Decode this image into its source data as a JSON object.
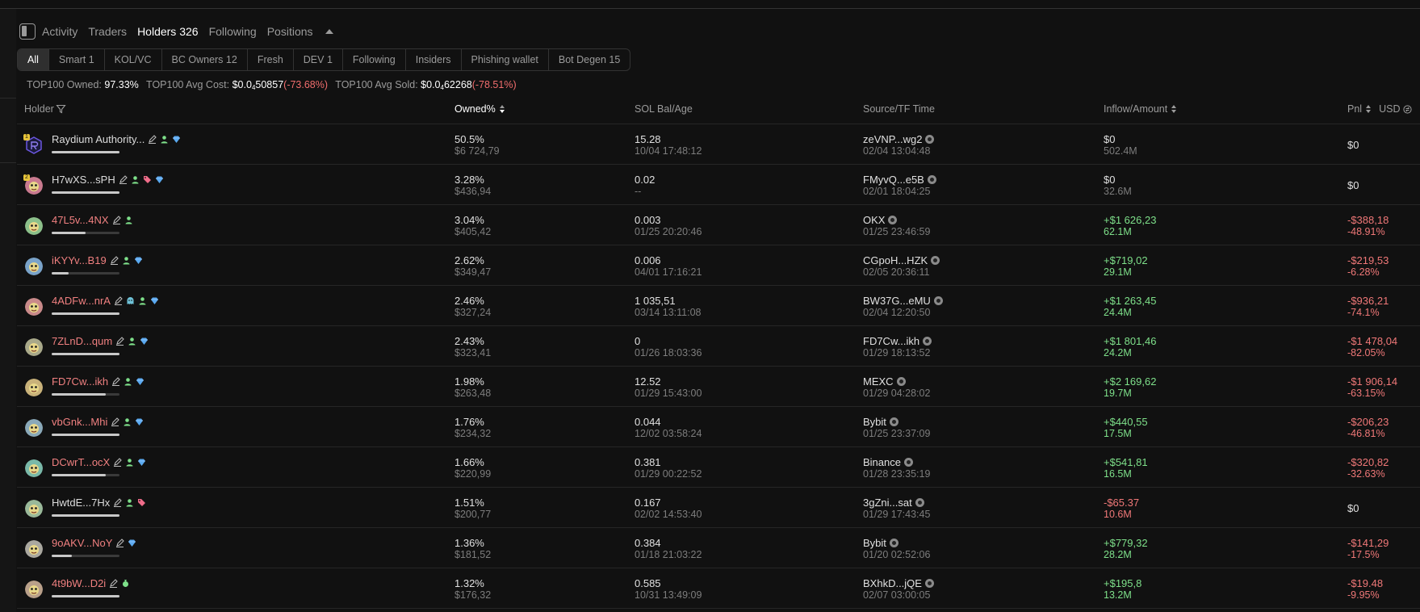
{
  "tabs": [
    {
      "label": "Activity",
      "active": false
    },
    {
      "label": "Traders",
      "active": false
    },
    {
      "label": "Holders 326",
      "active": true
    },
    {
      "label": "Following",
      "active": false
    },
    {
      "label": "Positions",
      "active": false
    }
  ],
  "filters": [
    {
      "label": "All",
      "active": true
    },
    {
      "label": "Smart 1"
    },
    {
      "label": "KOL/VC"
    },
    {
      "label": "BC Owners 12"
    },
    {
      "label": "Fresh"
    },
    {
      "label": "DEV 1"
    },
    {
      "label": "Following"
    },
    {
      "label": "Insiders"
    },
    {
      "label": "Phishing wallet"
    },
    {
      "label": "Bot Degen 15"
    }
  ],
  "summary": {
    "owned_label": "TOP100 Owned:",
    "owned_value": "97.33%",
    "avg_cost_label": "TOP100 Avg Cost:",
    "avg_cost_prefix": "$0.0",
    "avg_cost_sub": "4",
    "avg_cost_digits": "50857",
    "avg_cost_change": "(-73.68%)",
    "avg_sold_label": "TOP100 Avg Sold:",
    "avg_sold_prefix": "$0.0",
    "avg_sold_sub": "4",
    "avg_sold_digits": "62268",
    "avg_sold_change": "(-78.51%)"
  },
  "columns": {
    "holder": "Holder",
    "owned": "Owned%",
    "sol": "SOL Bal/Age",
    "source": "Source/TF Time",
    "inflow": "Inflow/Amount",
    "pnl": "Pnl",
    "usd": "USD"
  },
  "colors": {
    "green": "#7ee08a",
    "red": "#f07878",
    "pink": "#f08080",
    "bg": "#111111"
  },
  "rows": [
    {
      "rank": "1",
      "name": "Raydium Authority...",
      "name_color": "white",
      "icons": [
        "edit-icon",
        "user-icon",
        "diamond-icon"
      ],
      "bar": 1.0,
      "owned": "50.5%",
      "owned_usd": "$6 724,79",
      "sol": "15.28",
      "age": "10/04 17:48:12",
      "source": "zeVNP...wg2",
      "tf_time": "02/04 13:04:48",
      "inflow": "$0",
      "inflow_color": "white",
      "amount": "502.4M",
      "pnl": "$0",
      "pnl_pct": "",
      "pnl_color": "white"
    },
    {
      "rank": "2",
      "name": "H7wXS...sPH",
      "name_color": "white",
      "icons": [
        "edit-icon",
        "user-icon",
        "tag-icon",
        "diamond-icon"
      ],
      "bar": 1.0,
      "owned": "3.28%",
      "owned_usd": "$436,94",
      "sol": "0.02",
      "age": "--",
      "source": "FMyvQ...e5B",
      "tf_time": "02/01 18:04:25",
      "inflow": "$0",
      "inflow_color": "white",
      "amount": "32.6M",
      "pnl": "$0",
      "pnl_pct": "",
      "pnl_color": "white"
    },
    {
      "rank": "",
      "name": "47L5v...4NX",
      "name_color": "pink",
      "icons": [
        "edit-icon",
        "user-icon"
      ],
      "bar": 0.5,
      "owned": "3.04%",
      "owned_usd": "$405,42",
      "sol": "0.003",
      "age": "01/25 20:20:46",
      "source": "OKX",
      "tf_time": "01/25 23:46:59",
      "inflow": "+$1 626,23",
      "inflow_color": "green",
      "amount": "62.1M",
      "pnl": "-$388,18",
      "pnl_pct": "-48.91%",
      "pnl_color": "red"
    },
    {
      "rank": "",
      "name": "iKYYv...B19",
      "name_color": "pink",
      "icons": [
        "edit-icon",
        "user-icon",
        "diamond-icon"
      ],
      "bar": 0.25,
      "owned": "2.62%",
      "owned_usd": "$349,47",
      "sol": "0.006",
      "age": "04/01 17:16:21",
      "source": "CGpoH...HZK",
      "tf_time": "02/05 20:36:11",
      "inflow": "+$719,02",
      "inflow_color": "green",
      "amount": "29.1M",
      "pnl": "-$219,53",
      "pnl_pct": "-6.28%",
      "pnl_color": "red"
    },
    {
      "rank": "",
      "name": "4ADFw...nrA",
      "name_color": "pink",
      "icons": [
        "edit-icon",
        "ghost-icon",
        "user-icon",
        "diamond-icon"
      ],
      "bar": 1.0,
      "owned": "2.46%",
      "owned_usd": "$327,24",
      "sol": "1 035,51",
      "age": "03/14 13:11:08",
      "source": "BW37G...eMU",
      "tf_time": "02/04 12:20:50",
      "inflow": "+$1 263,45",
      "inflow_color": "green",
      "amount": "24.4M",
      "pnl": "-$936,21",
      "pnl_pct": "-74.1%",
      "pnl_color": "red"
    },
    {
      "rank": "",
      "name": "7ZLnD...qum",
      "name_color": "pink",
      "icons": [
        "edit-icon",
        "user-icon",
        "diamond-icon"
      ],
      "bar": 1.0,
      "owned": "2.43%",
      "owned_usd": "$323,41",
      "sol": "0",
      "age": "01/26 18:03:36",
      "source": "FD7Cw...ikh",
      "tf_time": "01/29 18:13:52",
      "inflow": "+$1 801,46",
      "inflow_color": "green",
      "amount": "24.2M",
      "pnl": "-$1 478,04",
      "pnl_pct": "-82.05%",
      "pnl_color": "red"
    },
    {
      "rank": "",
      "name": "FD7Cw...ikh",
      "name_color": "pink",
      "icons": [
        "edit-icon",
        "user-icon",
        "diamond-icon"
      ],
      "bar": 0.8,
      "owned": "1.98%",
      "owned_usd": "$263,48",
      "sol": "12.52",
      "age": "01/29 15:43:00",
      "source": "MEXC",
      "tf_time": "01/29 04:28:02",
      "inflow": "+$2 169,62",
      "inflow_color": "green",
      "amount": "19.7M",
      "pnl": "-$1 906,14",
      "pnl_pct": "-63.15%",
      "pnl_color": "red"
    },
    {
      "rank": "",
      "name": "vbGnk...Mhi",
      "name_color": "pink",
      "icons": [
        "edit-icon",
        "user-icon",
        "diamond-icon"
      ],
      "bar": 1.0,
      "owned": "1.76%",
      "owned_usd": "$234,32",
      "sol": "0.044",
      "age": "12/02 03:58:24",
      "source": "Bybit",
      "tf_time": "01/25 23:37:09",
      "inflow": "+$440,55",
      "inflow_color": "green",
      "amount": "17.5M",
      "pnl": "-$206,23",
      "pnl_pct": "-46.81%",
      "pnl_color": "red"
    },
    {
      "rank": "",
      "name": "DCwrT...ocX",
      "name_color": "pink",
      "icons": [
        "edit-icon",
        "user-icon",
        "diamond-icon"
      ],
      "bar": 0.8,
      "owned": "1.66%",
      "owned_usd": "$220,99",
      "sol": "0.381",
      "age": "01/29 00:22:52",
      "source": "Binance",
      "tf_time": "01/28 23:35:19",
      "inflow": "+$541,81",
      "inflow_color": "green",
      "amount": "16.5M",
      "pnl": "-$320,82",
      "pnl_pct": "-32.63%",
      "pnl_color": "red"
    },
    {
      "rank": "",
      "name": "HwtdE...7Hx",
      "name_color": "white",
      "icons": [
        "edit-icon",
        "user-icon",
        "tag-icon"
      ],
      "bar": 1.0,
      "owned": "1.51%",
      "owned_usd": "$200,77",
      "sol": "0.167",
      "age": "02/02 14:53:40",
      "source": "3gZni...sat",
      "tf_time": "01/29 17:43:45",
      "inflow": "-$65.37",
      "inflow_color": "red",
      "amount": "10.6M",
      "pnl": "$0",
      "pnl_pct": "",
      "pnl_color": "white"
    },
    {
      "rank": "",
      "name": "9oAKV...NoY",
      "name_color": "pink",
      "icons": [
        "edit-icon",
        "diamond-icon"
      ],
      "bar": 0.3,
      "owned": "1.36%",
      "owned_usd": "$181,52",
      "sol": "0.384",
      "age": "01/18 21:03:22",
      "source": "Bybit",
      "tf_time": "01/20 02:52:06",
      "inflow": "+$779,32",
      "inflow_color": "green",
      "amount": "28.2M",
      "pnl": "-$141,29",
      "pnl_pct": "-17.5%",
      "pnl_color": "red"
    },
    {
      "rank": "",
      "name": "4t9bW...D2i",
      "name_color": "pink",
      "icons": [
        "edit-icon",
        "moneybag-icon"
      ],
      "bar": 1.0,
      "owned": "1.32%",
      "owned_usd": "$176,32",
      "sol": "0.585",
      "age": "10/31 13:49:09",
      "source": "BXhkD...jQE",
      "tf_time": "02/07 03:00:05",
      "inflow": "+$195,8",
      "inflow_color": "green",
      "amount": "13.2M",
      "pnl": "-$19.48",
      "pnl_pct": "-9.95%",
      "pnl_color": "red"
    }
  ]
}
